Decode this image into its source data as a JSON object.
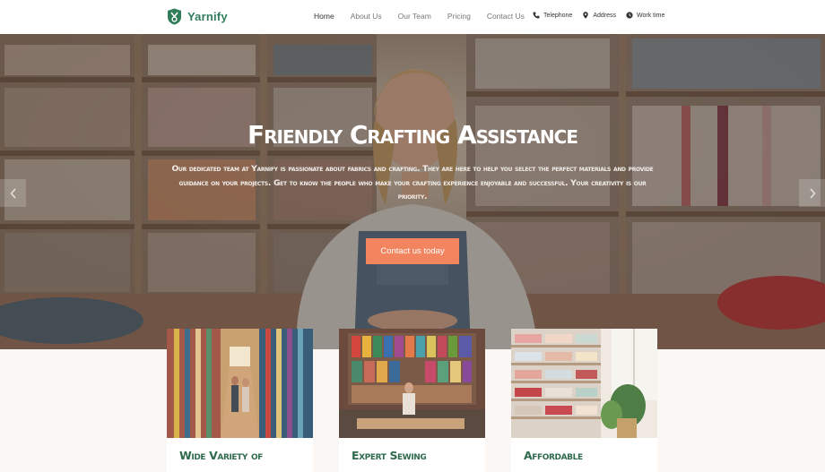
{
  "brand": {
    "name": "Yarnify",
    "accent": "#2f7d5a"
  },
  "nav": {
    "items": [
      {
        "label": "Home",
        "active": true
      },
      {
        "label": "About Us",
        "active": false
      },
      {
        "label": "Our Team",
        "active": false
      },
      {
        "label": "Pricing",
        "active": false
      },
      {
        "label": "Contact Us",
        "active": false
      }
    ]
  },
  "contact": {
    "telephone": {
      "label": "Telephone",
      "icon": "phone-icon"
    },
    "address": {
      "label": "Address",
      "icon": "map-pin-icon"
    },
    "worktime": {
      "label": "Work time",
      "icon": "clock-icon"
    }
  },
  "hero": {
    "title": "Friendly Crafting Assistance",
    "text": "Our dedicated team at Yarnify is passionate about fabrics and crafting. They are here to help you select the perfect materials and provide guidance on your projects. Get to know the people who make your crafting experience enjoyable and successful. Your creativity is our priority.",
    "button_label": "Contact us today",
    "button_color": "#f2855f",
    "prev_icon": "chevron-left-icon",
    "next_icon": "chevron-right-icon"
  },
  "cards": [
    {
      "title": "Wide Variety of"
    },
    {
      "title": "Expert Sewing"
    },
    {
      "title": "Affordable"
    }
  ]
}
